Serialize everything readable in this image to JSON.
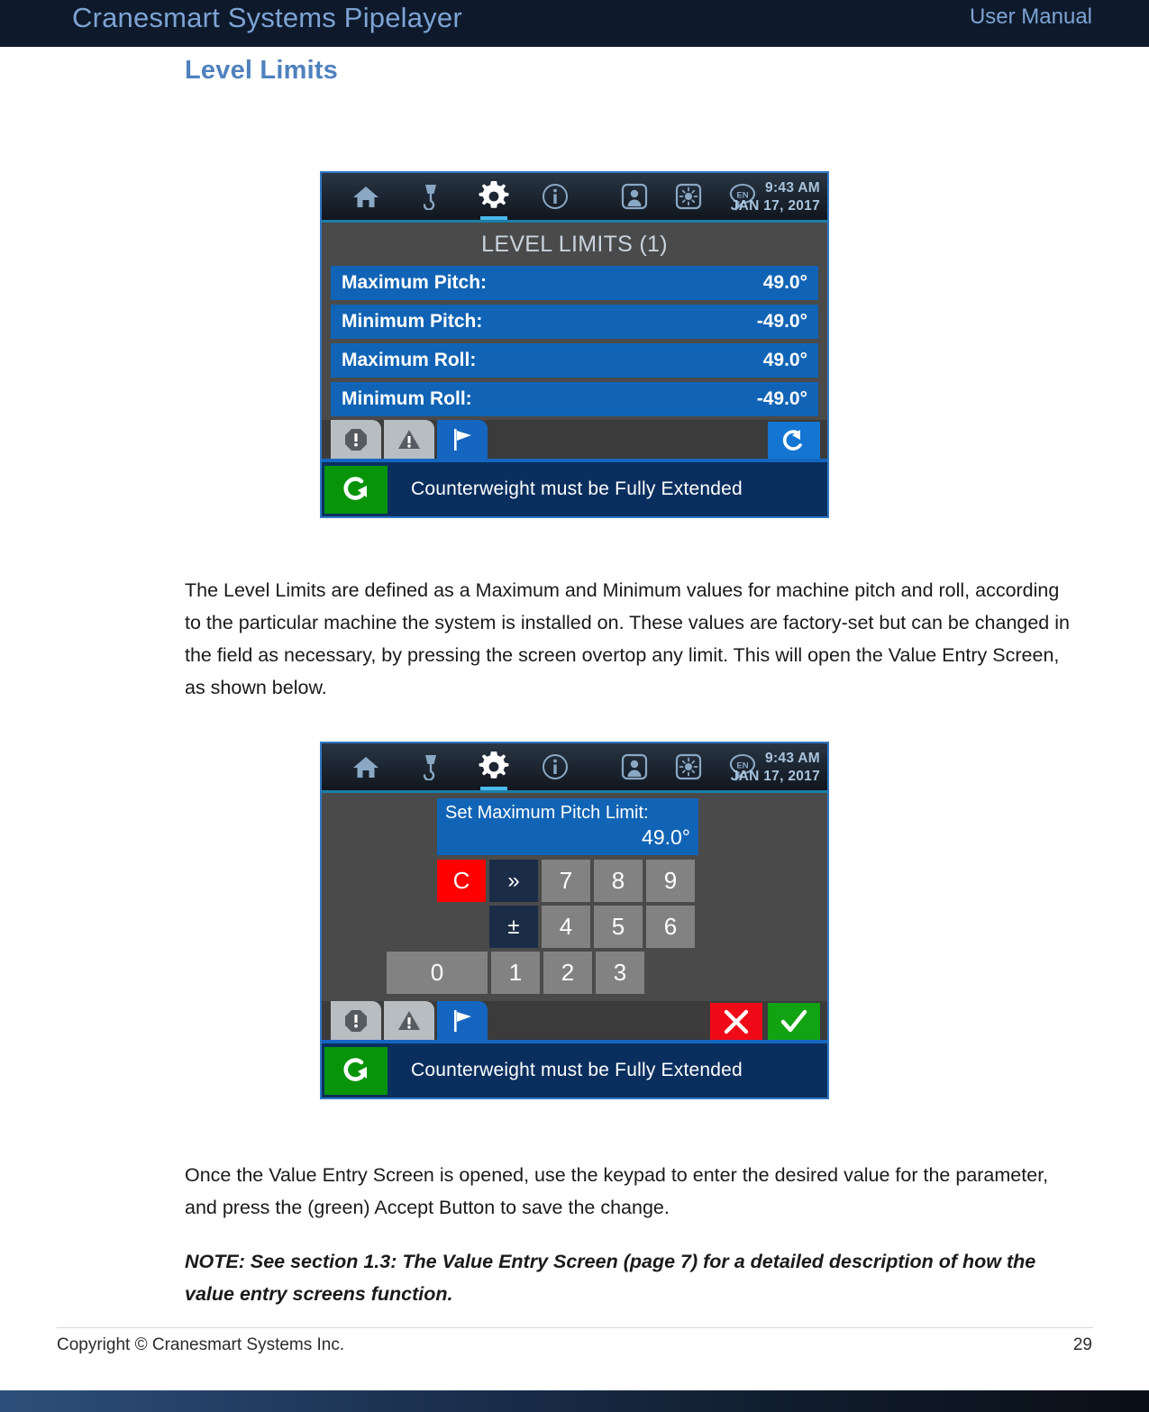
{
  "header": {
    "title": "Cranesmart Systems Pipelayer",
    "right_label": "User Manual"
  },
  "section": {
    "heading": "Level Limits"
  },
  "paragraphs": {
    "p1": "The Level Limits are defined as a Maximum and Minimum values for machine pitch and roll, according to the particular machine the system is installed on.  These values are factory-set but can be changed in the field as necessary, by pressing the screen overtop any limit.  This will open the Value Entry Screen, as shown below.",
    "p2": "Once the Value Entry Screen is opened, use the keypad to enter the desired value for the parameter, and press the (green) Accept Button to save the change.",
    "note": "NOTE: See section 1.3: The Value Entry Screen (page 7) for a detailed description of how the value entry screens function."
  },
  "device_nav": {
    "icons": [
      "home-icon",
      "hook-icon",
      "gear-icon",
      "info-icon",
      "operator-icon",
      "brightness-icon",
      "language-icon"
    ],
    "active_icon": "gear-icon",
    "language_code": "EN",
    "time": "9:43 AM",
    "date": "JAN 17, 2017"
  },
  "screenshot1": {
    "title": "LEVEL LIMITS (1)",
    "rows": [
      {
        "label": "Maximum Pitch:",
        "value": "49.0°"
      },
      {
        "label": "Minimum Pitch:",
        "value": "-49.0°"
      },
      {
        "label": "Maximum Roll:",
        "value": "49.0°"
      },
      {
        "label": "Minimum Roll:",
        "value": "-49.0°"
      }
    ],
    "tabs": [
      {
        "name": "alarm-tab",
        "icon": "exclamation-octagon-icon",
        "state": "inactive"
      },
      {
        "name": "warning-tab",
        "icon": "warning-triangle-icon",
        "state": "inactive"
      },
      {
        "name": "flag-tab",
        "icon": "flag-icon",
        "state": "active"
      }
    ],
    "back_button": {
      "icon": "back-arrow-icon"
    },
    "status": {
      "icon": "rotation-arrow-icon",
      "text": "Counterweight must be Fully Extended"
    }
  },
  "screenshot2": {
    "entry": {
      "label": "Set Maximum Pitch Limit:",
      "value": "49.0°"
    },
    "keypad": {
      "row1": [
        "C",
        "»",
        "7",
        "8",
        "9"
      ],
      "row2": [
        "",
        "±",
        "4",
        "5",
        "6"
      ],
      "row3": [
        "0",
        "1",
        "2",
        "3"
      ]
    },
    "tabs": [
      {
        "name": "alarm-tab",
        "icon": "exclamation-octagon-icon",
        "state": "inactive"
      },
      {
        "name": "warning-tab",
        "icon": "warning-triangle-icon",
        "state": "inactive"
      },
      {
        "name": "flag-tab",
        "icon": "flag-icon",
        "state": "active"
      }
    ],
    "cancel_button": {
      "icon": "x-icon"
    },
    "accept_button": {
      "icon": "check-icon"
    },
    "status": {
      "icon": "rotation-arrow-icon",
      "text": "Counterweight must be Fully Extended"
    }
  },
  "footer": {
    "copyright": "Copyright © Cranesmart Systems Inc.",
    "page_number": "29"
  },
  "colors": {
    "header_bg": "#0e1a2b",
    "heading": "#4f81bd",
    "row_blue": "#1164b5",
    "accent_blue": "#1566c0",
    "clear_red": "#fe0000",
    "accept_green": "#12a312",
    "status_bg": "#0a2f5e"
  }
}
